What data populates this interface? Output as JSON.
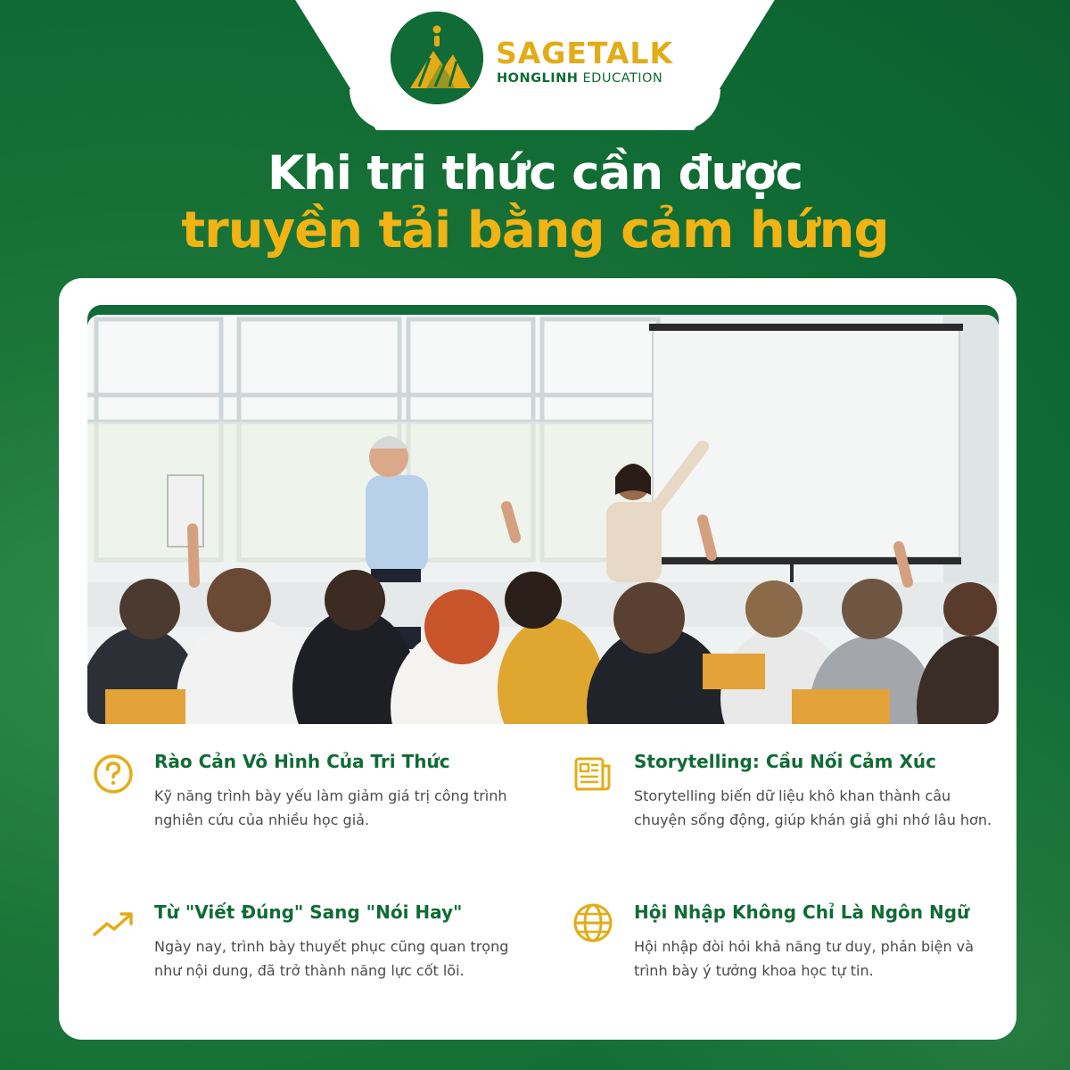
{
  "brand": {
    "name": "SAGETALK",
    "sub_bold": "HONGLINH",
    "sub_rest": " EDUCATION"
  },
  "headline": {
    "line1": "Khi tri thức cần được",
    "line2": "truyền tải bằng cảm hứng"
  },
  "colors": {
    "brand_green": "#106b36",
    "accent_gold": "#f2b315",
    "card_bg": "#ffffff"
  },
  "photo": {
    "subject": "classroom-presentation-photo"
  },
  "features": [
    {
      "icon": "question-circle-icon",
      "title": "Rào Cản Vô Hình Của Tri Thức",
      "desc": "Kỹ năng trình bày yếu làm giảm giá trị công trình nghiên cứu của nhiều học giả."
    },
    {
      "icon": "newspaper-icon",
      "title": "Storytelling: Cầu Nối Cảm Xúc",
      "desc": "Storytelling biến dữ liệu khô khan thành câu chuyện sống động, giúp khán giả ghi nhớ lâu hơn."
    },
    {
      "icon": "trending-up-icon",
      "title": "Từ \"Viết Đúng\" Sang \"Nói Hay\"",
      "desc": "Ngày nay, trình bày thuyết phục cũng quan trọng như nội dung, đã trở thành năng lực cốt lõi."
    },
    {
      "icon": "globe-icon",
      "title": "Hội Nhập Không Chỉ Là Ngôn Ngữ",
      "desc": "Hội nhập đòi hỏi khả năng tư duy, phản biện và trình bày ý tưởng khoa học tự tin."
    }
  ]
}
